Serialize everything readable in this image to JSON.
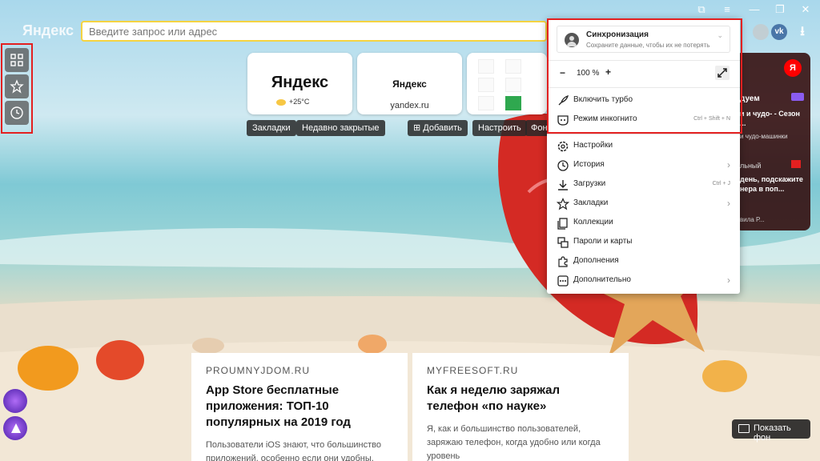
{
  "browser": {
    "brand": "Яндекс",
    "address_placeholder": "Введите запрос или адрес"
  },
  "tiles": [
    {
      "logo": "Яндекс",
      "weather": "+25°C"
    },
    {
      "logo": "Яндекс",
      "url": "yandex.ru"
    }
  ],
  "toolbar": {
    "bookmarks": "Закладки",
    "recently_closed": "Недавно закрытые",
    "add": "Добавить",
    "customize": "Настроить",
    "backgrounds": "Фон"
  },
  "feed": {
    "badge": "Я",
    "items": [
      {
        "tag": "дуем",
        "text": "и и чудо- - Сезон ..."
      },
      {
        "text": "и чудо-машинки"
      },
      {
        "tag": "льный",
        "text": "день, подскажите нера в поп..."
      },
      {
        "meta": "вила Р..."
      }
    ]
  },
  "menu": {
    "sync_title": "Синхронизация",
    "sync_sub": "Сохраните данные, чтобы их не потерять",
    "zoom_minus": "−",
    "zoom_value": "100 %",
    "zoom_plus": "+",
    "turbo": "Включить турбо",
    "incognito": "Режим инкогнито",
    "incognito_key": "Ctrl + Shift + N",
    "settings": "Настройки",
    "history": "История",
    "downloads": "Загрузки",
    "downloads_key": "Ctrl + J",
    "bookmarks": "Закладки",
    "collections": "Коллекции",
    "passwords": "Пароли и карты",
    "extensions": "Дополнения",
    "more": "Дополнительно"
  },
  "cards": [
    {
      "source": "PROUMNYJDOM.RU",
      "title": "App Store бесплатные приложения: ТОП-10 популярных на 2019 год",
      "desc": "Пользователи iOS знают, что большинство приложений, особенно если они удобны,"
    },
    {
      "source": "MYFREESOFT.RU",
      "title": "Как я неделю заряжал телефон «по науке»",
      "desc": "Я, как и большинство пользователей, заряжаю телефон, когда удобно или когда уровень"
    }
  ],
  "show_background": "Показать фон",
  "colors": {
    "accent_red": "#e32020",
    "address_border": "#f5d342",
    "yandex_red": "#ff0000"
  }
}
